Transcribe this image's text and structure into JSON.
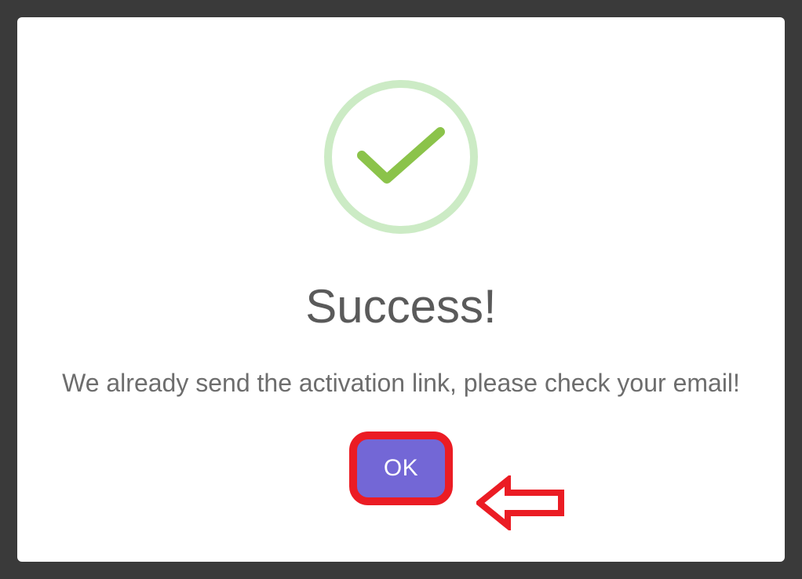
{
  "modal": {
    "title": "Success!",
    "message": "We already send the activation link, please check your email!",
    "button_label": "OK"
  },
  "icons": {
    "success": "check-icon"
  },
  "annotation": {
    "highlight_color": "#eb1c24",
    "arrow": "left-pointing-arrow"
  },
  "colors": {
    "button_bg": "#7367d6",
    "button_text": "#ffffff",
    "success_ring": "#ccebc5",
    "success_check": "#8bc34a",
    "title_text": "#5a5a5a",
    "body_text": "#6d6d6d"
  }
}
